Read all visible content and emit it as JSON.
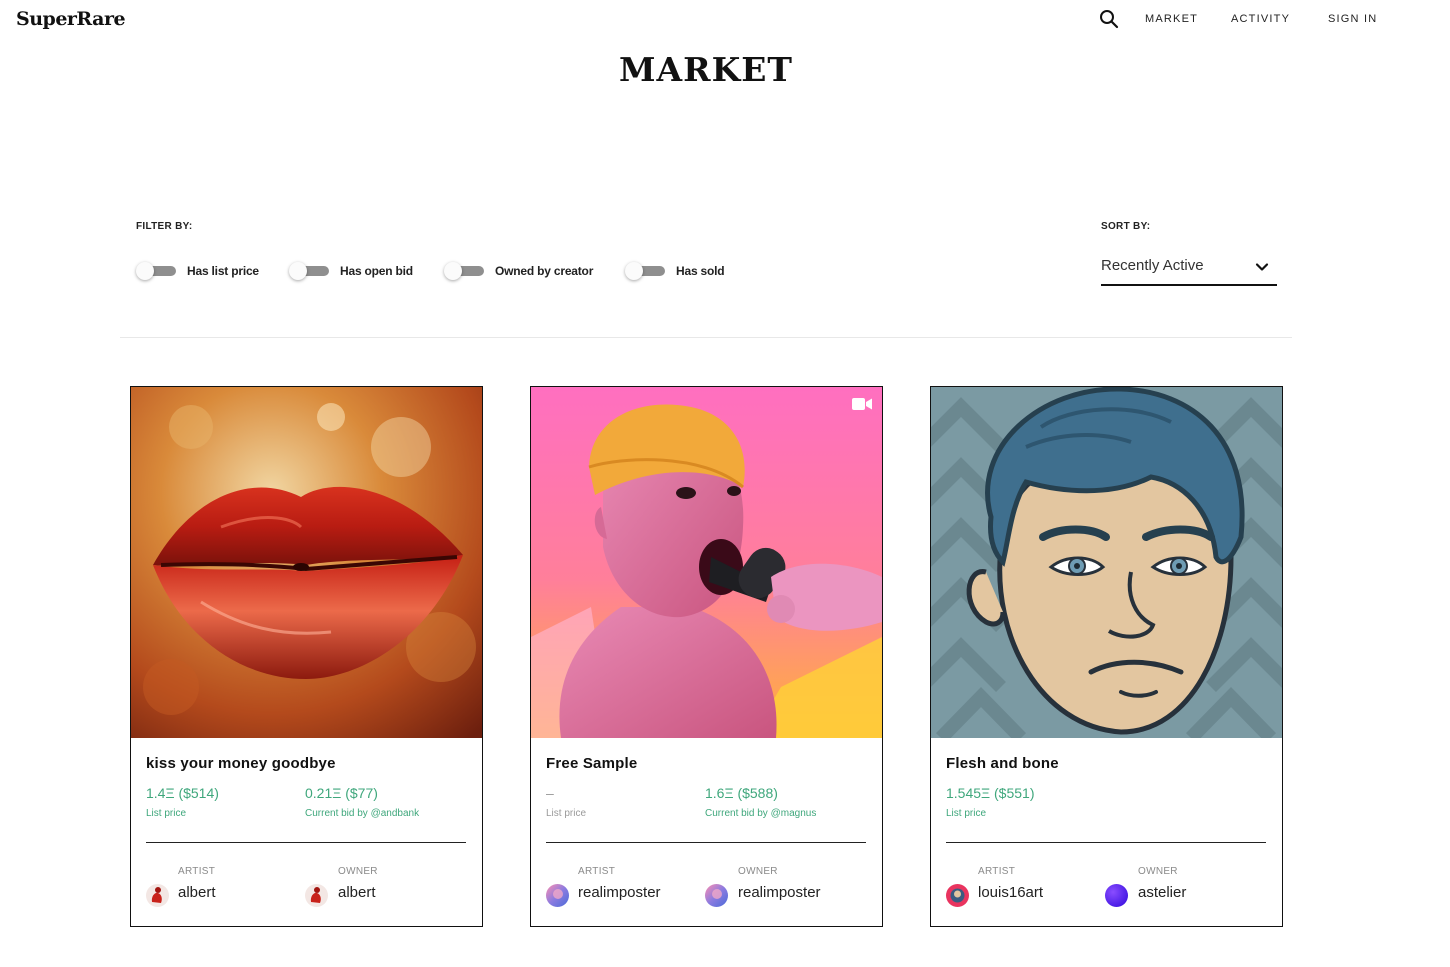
{
  "header": {
    "logo": "SuperRare",
    "nav": [
      {
        "label": "MARKET"
      },
      {
        "label": "ACTIVITY"
      },
      {
        "label": "SIGN IN"
      }
    ],
    "icon": "search-icon"
  },
  "page_title": "MARKET",
  "filters": {
    "label": "FILTER BY:",
    "items": [
      {
        "label": "Has list price",
        "on": false
      },
      {
        "label": "Has open bid",
        "on": false
      },
      {
        "label": "Owned by creator",
        "on": false
      },
      {
        "label": "Has sold",
        "on": false
      }
    ]
  },
  "sort": {
    "label": "SORT BY:",
    "value": "Recently Active",
    "icon": "chevron-down-icon"
  },
  "colors": {
    "price_green": "#3fa77c",
    "muted": "#9a9a9a"
  },
  "cards": [
    {
      "title": "kiss your money goodbye",
      "art": "red lips artwork",
      "video": false,
      "price1": "1.4Ξ ($514)",
      "price1_label": "List price",
      "price2": "0.21Ξ ($77)",
      "price2_label": "Current bid by @andbank",
      "artist_label": "ARTIST",
      "artist": "albert",
      "owner_label": "OWNER",
      "owner": "albert"
    },
    {
      "title": "Free Sample",
      "art": "pink figure with beanie artwork",
      "video": true,
      "price1": "–",
      "price1_label": "List price",
      "price2": "1.6Ξ ($588)",
      "price2_label": "Current bid by @magnus",
      "artist_label": "ARTIST",
      "artist": "realimposter",
      "owner_label": "OWNER",
      "owner": "realimposter"
    },
    {
      "title": "Flesh and bone",
      "art": "cartoon face portrait artwork",
      "video": false,
      "price1": "1.545Ξ ($551)",
      "price1_label": "List price",
      "price2": "",
      "price2_label": "",
      "artist_label": "ARTIST",
      "artist": "louis16art",
      "owner_label": "OWNER",
      "owner": "astelier"
    }
  ]
}
